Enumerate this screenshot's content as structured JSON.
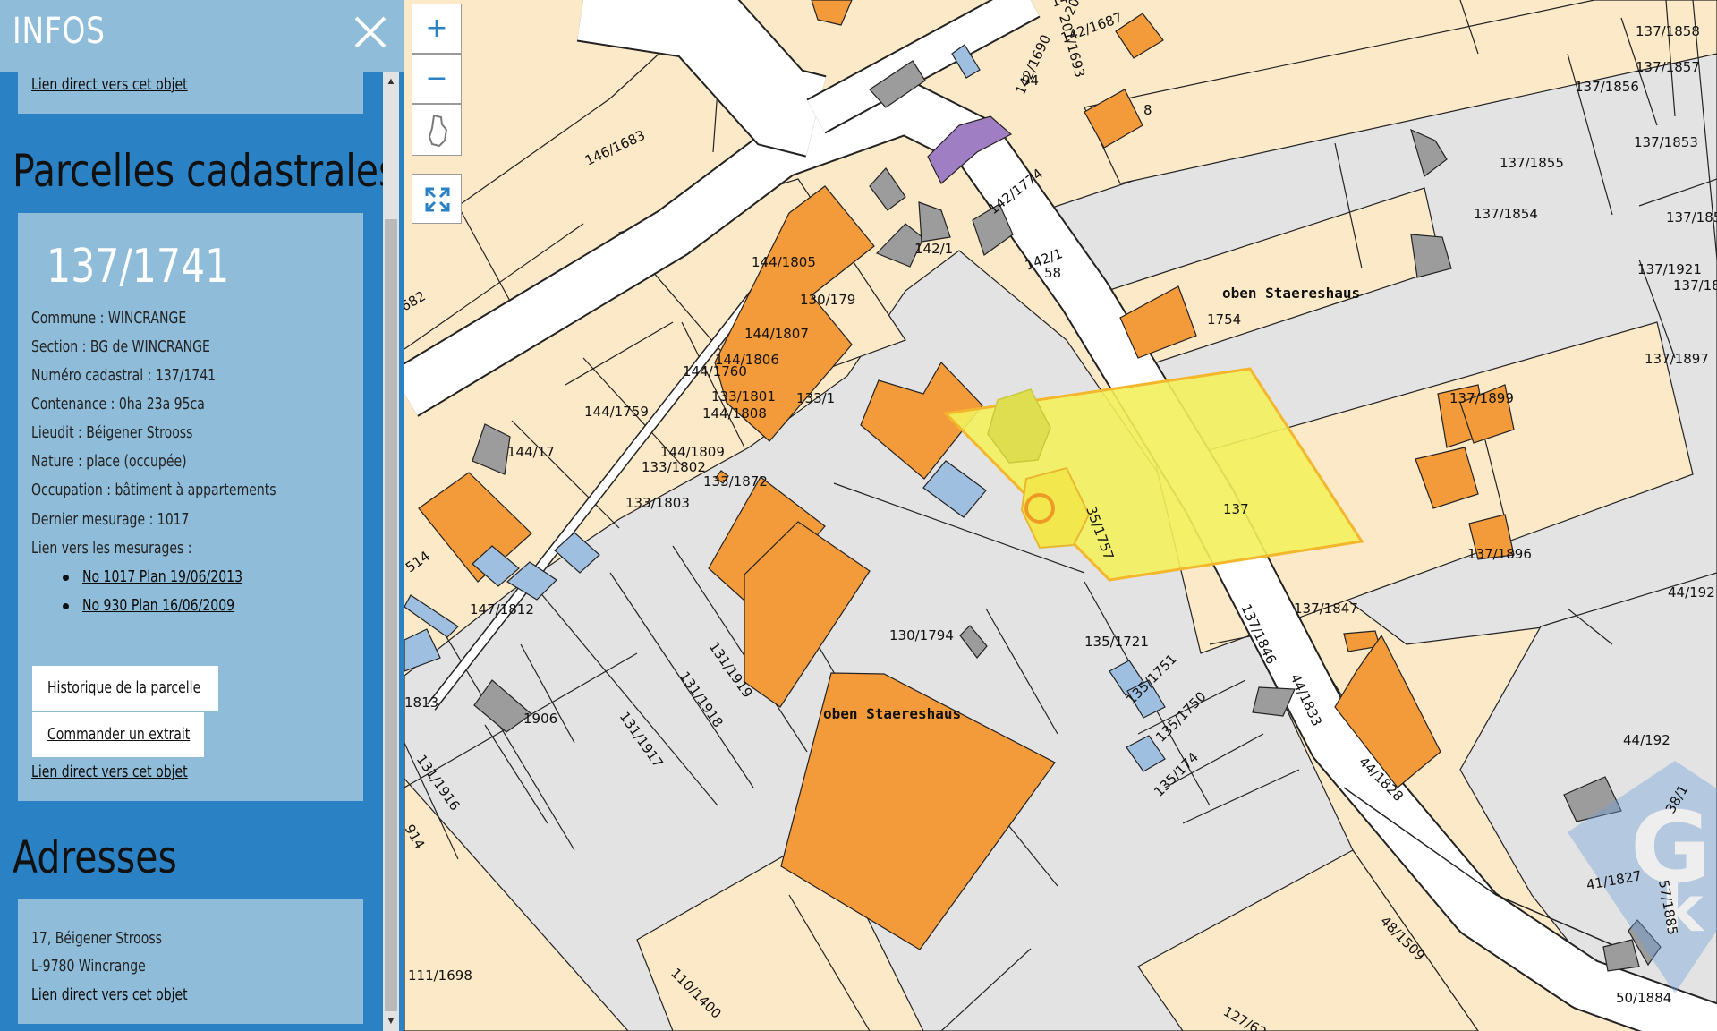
{
  "sidebar": {
    "title": "INFOS",
    "top_card_link": "Lien direct vers cet objet",
    "parcel_section": {
      "heading": "Parcelles cadastrales",
      "parcel_id": "137/1741",
      "commune": "Commune : WINCRANGE",
      "section": "Section : BG de WINCRANGE",
      "numero": "Numéro cadastral : 137/1741",
      "contenance": "Contenance : 0ha 23a 95ca",
      "lieudit": "Lieudit : Béigener Strooss",
      "nature": "Nature : place (occupée)",
      "occupation": "Occupation : bâtiment à appartements",
      "dernier_mesurage": "Dernier mesurage : 1017",
      "mesurages_label": "Lien vers les mesurages :",
      "mesurages": [
        "No 1017 Plan 19/06/2013",
        "No 930 Plan 16/06/2009"
      ],
      "history_button": "Historique de la parcelle",
      "order_button": "Commander un extrait",
      "direct_link": "Lien direct vers cet objet"
    },
    "address_section": {
      "heading": "Adresses",
      "street": "17, Béigener Strooss",
      "city": "L-9780 Wincrange",
      "direct_link": "Lien direct vers cet objet"
    }
  },
  "map_controls": {
    "zoom_in": "+",
    "zoom_out": "−"
  },
  "map": {
    "colors": {
      "parcel": "#fbe9c8",
      "built_area": "#e3e3e3",
      "building_main": "#f39a3a",
      "building_annex": "#9c9c9c",
      "building_small": "#9fbfe0",
      "building_special": "#a07ec4",
      "selected": "#f3f15c",
      "road": "#ffffff",
      "sidebar_blue": "#2a82c4",
      "card_blue": "#8fbcd8"
    },
    "place_labels": [
      "oben Staereshaus",
      "oben Staereshaus"
    ],
    "parcel_labels": [
      "146/1683",
      "144/1805",
      "142/1687",
      "137/1858",
      "137/1857",
      "137/1856",
      "137/1855",
      "137/1853",
      "137/1854",
      "137/185",
      "142/1774",
      "142/1690",
      "201/1693",
      "201/16",
      "141/",
      "94",
      "8",
      "142/1",
      "1754",
      "137/1899",
      "137/1897",
      "137/1896",
      "137/1847",
      "137/1846",
      "44/1833",
      "44/1828",
      "41/1827",
      "57/1885",
      "48/1509",
      "50/1884",
      "44/192",
      "44/192",
      "38/1",
      "130/179",
      "144/1807",
      "144/1806",
      "144/1760",
      "133/1801",
      "144/1808",
      "144/1759",
      "144/1809",
      "133/1802",
      "133/1872",
      "133/1803",
      "144/17",
      "130/1794",
      "131/1919",
      "131/1918",
      "131/1917",
      "131/1916",
      "147/1812",
      "1906",
      "135/1721",
      "135/1751",
      "135/1750",
      "135/174",
      "35/1757",
      "110/1400",
      "111/1698",
      "127/62",
      "682",
      "514",
      "1813",
      "914",
      "133/1",
      "137/1921",
      "137/18",
      "137",
      "58",
      "142/1"
    ]
  }
}
